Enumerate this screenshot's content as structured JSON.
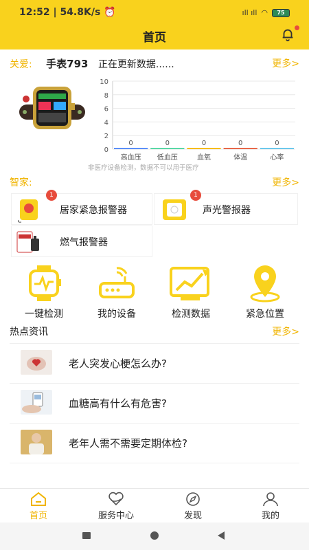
{
  "status_bar": {
    "time": "12:52",
    "speed": "| 54.8K/s",
    "signal": "ıll ıll",
    "battery": "75"
  },
  "header": {
    "title": "首页"
  },
  "care": {
    "label": "关爱:",
    "device_name": "手表793",
    "status": "正在更新数据......",
    "more": "更多>"
  },
  "chart_data": {
    "type": "bar",
    "categories": [
      "高血压",
      "低血压",
      "血氧",
      "体温",
      "心率"
    ],
    "values": [
      0,
      0,
      0,
      0,
      0
    ],
    "value_labels": [
      "0",
      "0",
      "0",
      "0",
      "0"
    ],
    "y_ticks": [
      "0",
      "2",
      "4",
      "6",
      "8",
      "10"
    ],
    "ylim": [
      0,
      10
    ],
    "grid": true,
    "series_colors": [
      "#5b8ff9",
      "#5ad8a6",
      "#f6bd16",
      "#e8684a",
      "#6dc8ec"
    ],
    "note": "非医疗设备检测，数据不可以用于医疗"
  },
  "smart_home": {
    "label": "智家:",
    "more": "更多>",
    "devices": [
      {
        "label": "居家紧急报警器",
        "badge": "1",
        "icon": "emergency-alarm-icon"
      },
      {
        "label": "声光警报器",
        "badge": "1",
        "icon": "siren-icon"
      },
      {
        "label": "燃气报警器",
        "badge": "",
        "icon": "gas-alarm-icon"
      }
    ]
  },
  "features": [
    {
      "label": "一键检测",
      "icon": "watch-pulse-icon"
    },
    {
      "label": "我的设备",
      "icon": "router-icon"
    },
    {
      "label": "检测数据",
      "icon": "chart-trend-icon"
    },
    {
      "label": "紧急位置",
      "icon": "location-pin-icon"
    }
  ],
  "news": {
    "label": "热点资讯",
    "more": "更多>",
    "items": [
      {
        "title": "老人突发心梗怎么办?"
      },
      {
        "title": "血糖高有什么有危害?"
      },
      {
        "title": "老年人需不需要定期体检?"
      }
    ]
  },
  "tabs": [
    {
      "label": "首页",
      "icon": "home-icon",
      "active": true
    },
    {
      "label": "服务中心",
      "icon": "heart-hand-icon",
      "active": false
    },
    {
      "label": "发现",
      "icon": "compass-icon",
      "active": false
    },
    {
      "label": "我的",
      "icon": "user-icon",
      "active": false
    }
  ],
  "colors": {
    "accent": "#f9d21d",
    "accent_text": "#f0b400",
    "badge": "#e74c3c"
  }
}
